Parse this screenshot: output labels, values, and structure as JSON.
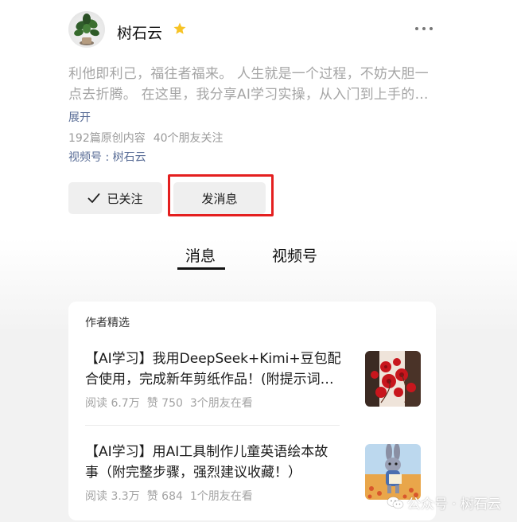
{
  "profile": {
    "name": "树石云",
    "bio": "利他即利己，福往者福来。 人生就是一个过程，不妨大胆一点去折腾。 在这里，我分享AI学习实操，从入门到上手的…",
    "expand": "展开",
    "original_count": "192篇原创内容",
    "friends_follow": "40个朋友关注",
    "channel": "视频号 : 树石云"
  },
  "actions": {
    "follow_label": "已关注",
    "message_label": "发消息"
  },
  "tabs": [
    {
      "label": "消息",
      "active": true
    },
    {
      "label": "视频号",
      "active": false
    }
  ],
  "featured": {
    "title": "作者精选",
    "articles": [
      {
        "title": "【AI学习】我用DeepSeek+Kimi+豆包配合使用，完成新年剪纸作品！(附提示词…",
        "reads": "阅读 6.7万",
        "likes": "赞 750",
        "friends": "3个朋友在看",
        "thumb_icon": "red-papercut-flowers"
      },
      {
        "title": "【AI学习】用AI工具制作儿童英语绘本故事（附完整步骤，强烈建议收藏！）",
        "reads": "阅读 3.3万",
        "likes": "赞 684",
        "friends": "1个朋友在看",
        "thumb_icon": "cartoon-rabbit"
      }
    ]
  },
  "watermark": {
    "text": "公众号 · 树石云",
    "icon": "wechat-icon"
  },
  "colors": {
    "link": "#576b95",
    "highlight": "#e41f1f",
    "star": "#f7c325"
  }
}
